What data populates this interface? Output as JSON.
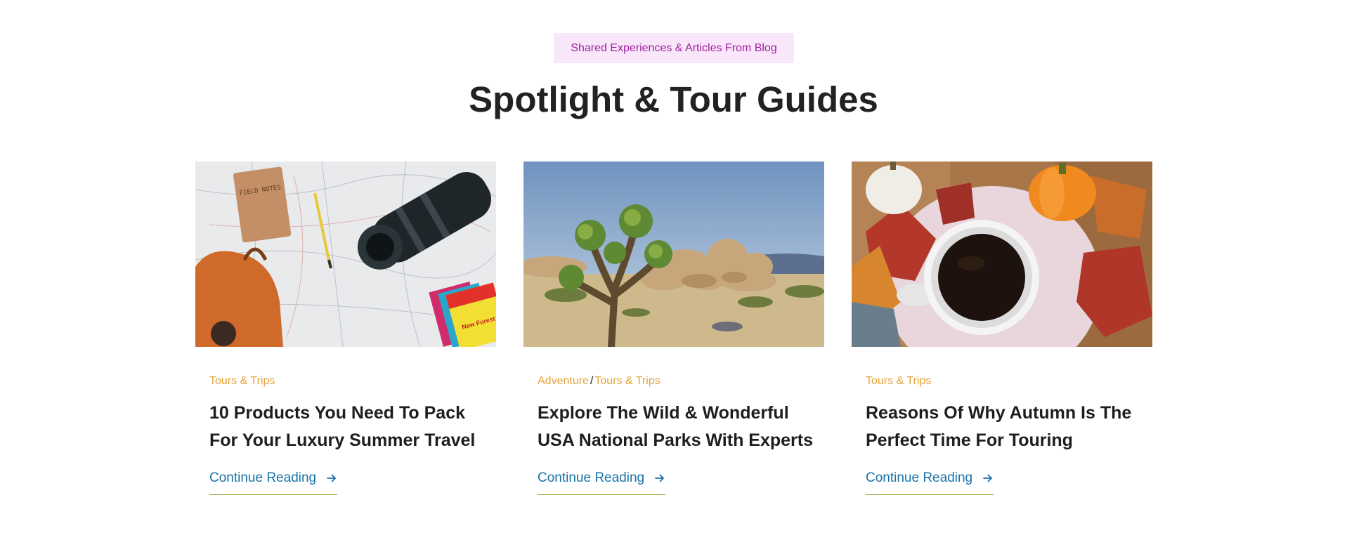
{
  "section": {
    "eyebrow": "Shared Experiences & Articles From Blog",
    "heading": "Spotlight & Tour Guides"
  },
  "colors": {
    "eyebrow_bg": "#f9e6fb",
    "eyebrow_text": "#a1219e",
    "category": "#e6a23a",
    "link": "#1872a8",
    "link_underline": "#8fa12b"
  },
  "cards": [
    {
      "image": "travel-flatlay-map-camera-backpack",
      "image_text": {
        "notebook": "FIELD NOTES",
        "map_book": "New Forest"
      },
      "categories": [
        "Tours & Trips"
      ],
      "title": "10 Products You Need To Pack For Your Luxury Summer Travel",
      "cta": "Continue Reading"
    },
    {
      "image": "joshua-tree-desert-landscape",
      "categories": [
        "Adventure",
        "Tours & Trips"
      ],
      "category_separator": "/",
      "title": "Explore The Wild & Wonderful USA National Parks With Experts",
      "cta": "Continue Reading"
    },
    {
      "image": "autumn-coffee-cup-pumpkins-leaves",
      "categories": [
        "Tours & Trips"
      ],
      "title": "Reasons Of Why Autumn Is The Perfect Time For Touring",
      "cta": "Continue Reading"
    }
  ]
}
